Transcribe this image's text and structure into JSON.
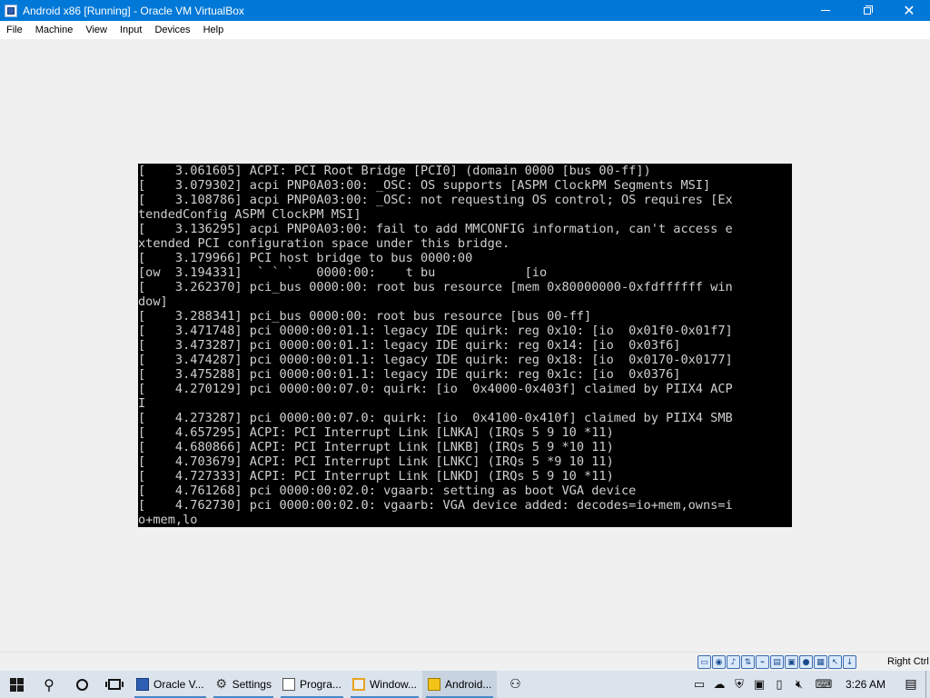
{
  "window": {
    "title": "Android x86 [Running] - Oracle VM VirtualBox"
  },
  "menu": [
    "File",
    "Machine",
    "View",
    "Input",
    "Devices",
    "Help"
  ],
  "console_lines": [
    "[    3.061605] ACPI: PCI Root Bridge [PCI0] (domain 0000 [bus 00-ff])",
    "[    3.079302] acpi PNP0A03:00: _OSC: OS supports [ASPM ClockPM Segments MSI]",
    "[    3.108786] acpi PNP0A03:00: _OSC: not requesting OS control; OS requires [Ex",
    "tendedConfig ASPM ClockPM MSI]",
    "[    3.136295] acpi PNP0A03:00: fail to add MMCONFIG information, can't access e",
    "xtended PCI configuration space under this bridge.",
    "[    3.179966] PCI host bridge to bus 0000:00",
    "[ow  3.194331]  ` ` `   0000:00:    t bu            [io",
    "[    3.262370] pci_bus 0000:00: root bus resource [mem 0x80000000-0xfdffffff win",
    "dow]",
    "[    3.288341] pci_bus 0000:00: root bus resource [bus 00-ff]",
    "[    3.471748] pci 0000:00:01.1: legacy IDE quirk: reg 0x10: [io  0x01f0-0x01f7]",
    "[    3.473287] pci 0000:00:01.1: legacy IDE quirk: reg 0x14: [io  0x03f6]",
    "[    3.474287] pci 0000:00:01.1: legacy IDE quirk: reg 0x18: [io  0x0170-0x0177]",
    "[    3.475288] pci 0000:00:01.1: legacy IDE quirk: reg 0x1c: [io  0x0376]",
    "[    4.270129] pci 0000:00:07.0: quirk: [io  0x4000-0x403f] claimed by PIIX4 ACP",
    "I",
    "[    4.273287] pci 0000:00:07.0: quirk: [io  0x4100-0x410f] claimed by PIIX4 SMB",
    "[    4.657295] ACPI: PCI Interrupt Link [LNKA] (IRQs 5 9 10 *11)",
    "[    4.680866] ACPI: PCI Interrupt Link [LNKB] (IRQs 5 9 *10 11)",
    "[    4.703679] ACPI: PCI Interrupt Link [LNKC] (IRQs 5 *9 10 11)",
    "[    4.727333] ACPI: PCI Interrupt Link [LNKD] (IRQs 5 9 10 *11)",
    "[    4.761268] pci 0000:00:02.0: vgaarb: setting as boot VGA device",
    "[    4.762730] pci 0000:00:02.0: vgaarb: VGA device added: decodes=io+mem,owns=i",
    "o+mem,lo"
  ],
  "status_bar": {
    "icons": [
      "hard-disk-icon",
      "optical-drive-icon",
      "audio-icon",
      "network-icon",
      "usb-icon",
      "shared-folder-icon",
      "display-icon",
      "video-capture-icon",
      "cpu-icon",
      "mouse-integration-icon",
      "keyboard-icon"
    ],
    "host_key": "Right Ctrl"
  },
  "taskbar": {
    "apps": [
      {
        "label": "Oracle V...",
        "icon": "virtualbox-icon"
      },
      {
        "label": "Settings",
        "icon": "gear-icon"
      },
      {
        "label": "Progra...",
        "icon": "program-icon"
      },
      {
        "label": "Window...",
        "icon": "window-icon"
      },
      {
        "label": "Android...",
        "icon": "android-vm-icon"
      }
    ],
    "tray_icons": [
      "keyboard-tray-icon",
      "onedrive-icon",
      "defender-icon",
      "network-tray-icon",
      "battery-icon",
      "volume-mute-icon",
      "input-keyboard-icon"
    ],
    "clock": "3:26 AM"
  }
}
